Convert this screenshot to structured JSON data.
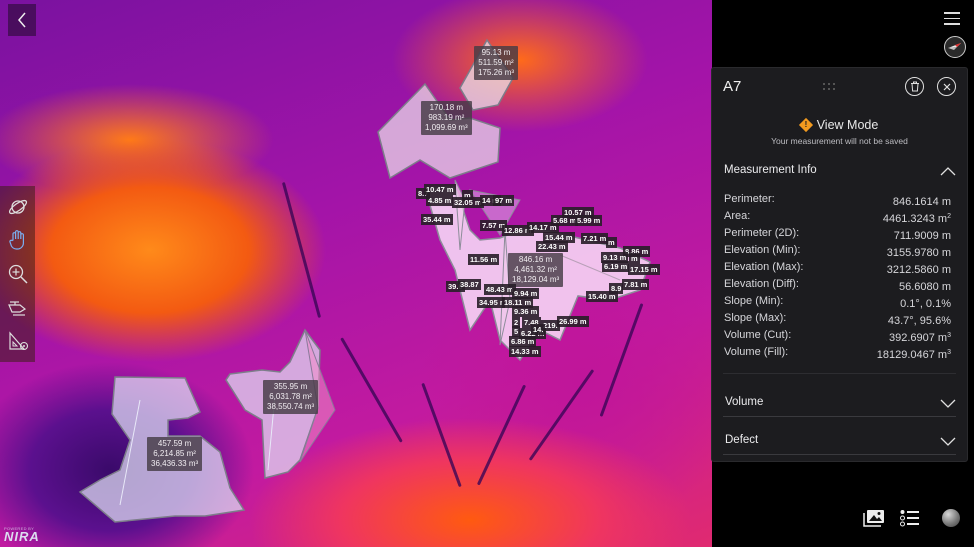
{
  "map": {
    "polygons": [
      {
        "id": "A-small-top",
        "perimeter": "95.13 m",
        "area": "511.59 m²",
        "volume": "175.26 m³"
      },
      {
        "id": "A-mid-top",
        "perimeter": "170.18 m",
        "area": "983.19 m²",
        "volume": "1,099.69 m³"
      },
      {
        "id": "A-left-bottom",
        "perimeter": "457.59 m",
        "area": "6,214.85 m²",
        "volume": "36,436.33 m³"
      },
      {
        "id": "A-right-bottom",
        "perimeter": "355.95 m",
        "area": "6,031.78 m²",
        "volume": "38,550.74 m³"
      },
      {
        "id": "A7",
        "perimeter": "846.16 m",
        "area": "4,461.32 m²",
        "volume": "18,129.04 m³"
      }
    ],
    "segment_labels": [
      "8.7",
      "10.47 m",
      "m",
      "4.85 m",
      "32.05 m",
      "14 m",
      "97 m",
      "35.44 m",
      "7.57 m",
      "12.86 m",
      "14.17 m",
      "10.57 m",
      "5.68 m",
      "5.99 m",
      "15.44 m",
      "22.43 m",
      "7.21 m",
      "m",
      "8.86 m",
      "9.13 m",
      "m",
      "6.19 m",
      "17.15 m",
      "11.56 m",
      "39.0",
      "38.87",
      "48.43 m",
      "9.94 m",
      "34.95 r",
      "18.11 m",
      "9.36 m",
      "7.48",
      "2",
      "219.",
      "26.99 m",
      "5",
      "6.22 m",
      "14.",
      "6.86 m",
      "14.33 m",
      "15.40 m",
      "8.9",
      "7.81 m"
    ]
  },
  "left_toolbar": {
    "back_icon": "chevron-left-icon",
    "tools": [
      {
        "name": "orbit",
        "icon": "planet-icon"
      },
      {
        "name": "pan",
        "icon": "hand-icon"
      },
      {
        "name": "zoom",
        "icon": "zoom-in-icon"
      },
      {
        "name": "drone",
        "icon": "helicopter-icon"
      },
      {
        "name": "measure",
        "icon": "ruler-triangle-icon"
      }
    ]
  },
  "branding": {
    "powered_by": "POWERED BY",
    "name": "NIRA"
  },
  "panel": {
    "title": "A7",
    "view_mode": "View Mode",
    "view_mode_sub": "Your measurement will not be saved",
    "info_header": "Measurement Info",
    "rows": [
      {
        "label": "Perimeter:",
        "value": "846.1614 m",
        "sup": ""
      },
      {
        "label": "Area:",
        "value": "4461.3243 m",
        "sup": "2"
      },
      {
        "label": "Perimeter (2D):",
        "value": "711.9009 m",
        "sup": ""
      },
      {
        "label": "Elevation (Min):",
        "value": "3155.9780 m",
        "sup": ""
      },
      {
        "label": "Elevation (Max):",
        "value": "3212.5860 m",
        "sup": ""
      },
      {
        "label": "Elevation (Diff):",
        "value": "56.6080 m",
        "sup": ""
      },
      {
        "label": "Slope (Min):",
        "value": "0.1°, 0.1%",
        "sup": ""
      },
      {
        "label": "Slope (Max):",
        "value": "43.7°, 95.6%",
        "sup": ""
      },
      {
        "label": "Volume (Cut):",
        "value": "392.6907 m",
        "sup": "3"
      },
      {
        "label": "Volume (Fill):",
        "value": "18129.0467 m",
        "sup": "3"
      }
    ],
    "sections": [
      {
        "label": "Volume"
      },
      {
        "label": "Defect"
      }
    ]
  },
  "colors": {
    "panel_bg": "#1c1c1f",
    "warning": "#f29a1f",
    "polygon_fill": "#e6e0f0",
    "label_bg": "#463c46"
  }
}
